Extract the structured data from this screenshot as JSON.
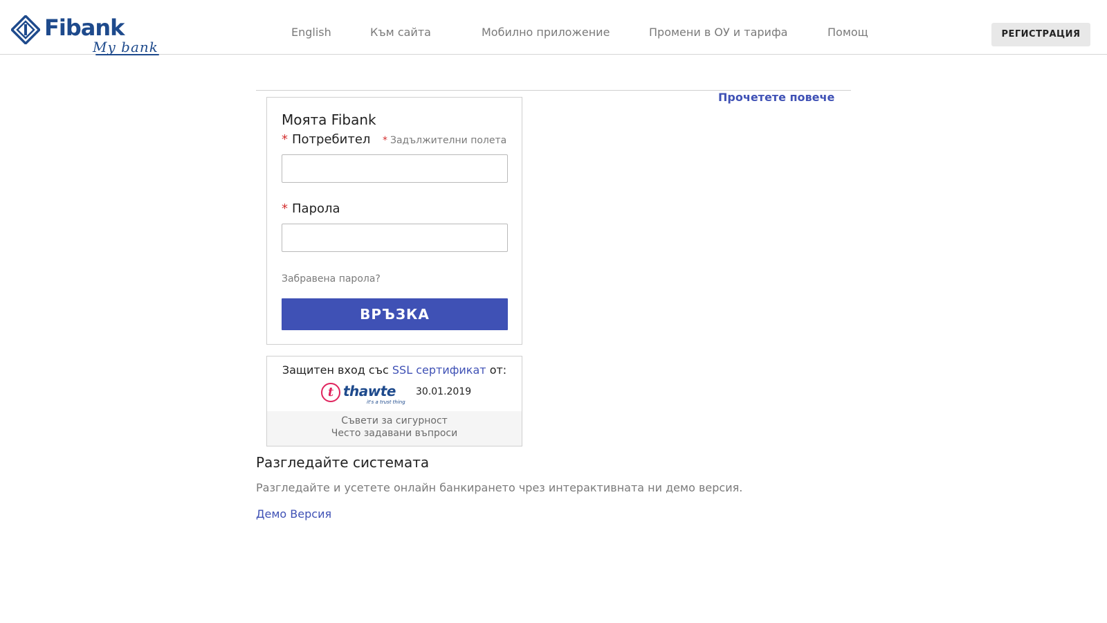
{
  "brand": {
    "name": "Fibank",
    "tagline": "My bank",
    "primary_color": "#1e4a8c",
    "accent_color": "#3f51b5"
  },
  "nav": {
    "english": "English",
    "to_site": "Към сайта",
    "mobile_app": "Мобилно приложение",
    "terms_changes": "Промени в ОУ и тарифа",
    "help": "Помощ",
    "register": "РЕГИСТРАЦИЯ"
  },
  "content": {
    "read_more": "Прочетете повече"
  },
  "login": {
    "title": "Моята Fibank",
    "required_marker": "*",
    "username_label": "Потребител",
    "required_note": "Задължителни полета",
    "username_value": "",
    "password_label": "Парола",
    "password_value": "",
    "forgot_password": "Забравена парола?",
    "submit": "ВРЪЗКА"
  },
  "ssl": {
    "prefix": "Защитен вход със",
    "link": "SSL сертификат",
    "suffix": "от:",
    "provider_logo": "thawte",
    "provider_logo_tagline": "it's a trust thing",
    "date": "30.01.2019",
    "security_tips": "Съвети за сигурност",
    "faq": "Често задавани въпроси"
  },
  "explore": {
    "title": "Разгледайте системата",
    "text": "Разгледайте и усетете онлайн банкирането чрез интерактивната ни демо версия.",
    "demo_link": "Демо Версия"
  }
}
